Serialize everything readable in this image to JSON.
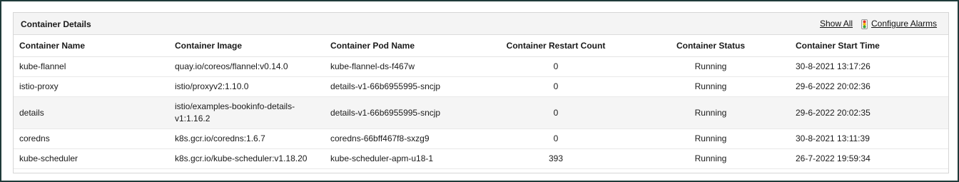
{
  "panel": {
    "title": "Container Details",
    "show_all": "Show All",
    "configure_alarms": "Configure Alarms"
  },
  "columns": [
    "Container Name",
    "Container Image",
    "Container Pod Name",
    "Container Restart Count",
    "Container Status",
    "Container Start Time"
  ],
  "rows": [
    {
      "name": "kube-flannel",
      "image": "quay.io/coreos/flannel:v0.14.0",
      "pod": "kube-flannel-ds-f467w",
      "restarts": "0",
      "status": "Running",
      "start": "30-8-2021 13:17:26"
    },
    {
      "name": "istio-proxy",
      "image": "istio/proxyv2:1.10.0",
      "pod": "details-v1-66b6955995-sncjp",
      "restarts": "0",
      "status": "Running",
      "start": "29-6-2022 20:02:36"
    },
    {
      "name": "details",
      "image": "istio/examples-bookinfo-details-v1:1.16.2",
      "pod": "details-v1-66b6955995-sncjp",
      "restarts": "0",
      "status": "Running",
      "start": "29-6-2022 20:02:35"
    },
    {
      "name": "coredns",
      "image": "k8s.gcr.io/coredns:1.6.7",
      "pod": "coredns-66bff467f8-sxzg9",
      "restarts": "0",
      "status": "Running",
      "start": "30-8-2021 13:11:39"
    },
    {
      "name": "kube-scheduler",
      "image": "k8s.gcr.io/kube-scheduler:v1.18.20",
      "pod": "kube-scheduler-apm-u18-1",
      "restarts": "393",
      "status": "Running",
      "start": "26-7-2022 19:59:34"
    }
  ],
  "icons": {
    "alarm": "traffic-light-icon"
  }
}
